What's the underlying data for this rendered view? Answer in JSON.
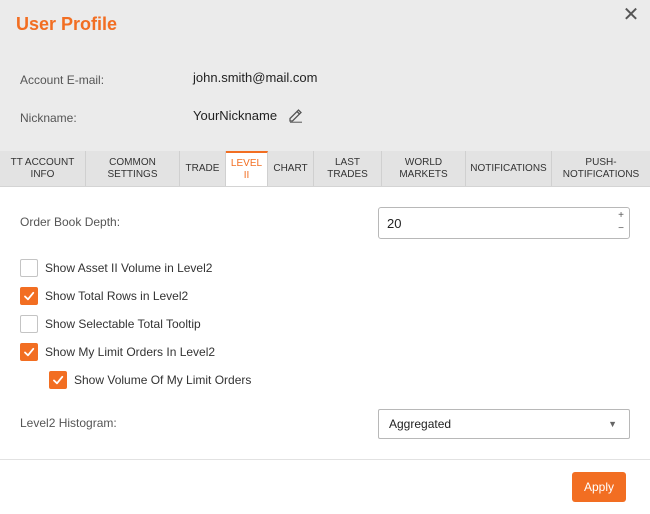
{
  "dialog": {
    "title": "User Profile",
    "close_icon": "close-icon"
  },
  "account": {
    "email_label": "Account E-mail:",
    "email_value": "john.smith@mail.com",
    "nickname_label": "Nickname:",
    "nickname_value": "YourNickname",
    "edit_icon": "pencil-icon"
  },
  "tabs": [
    {
      "label": "TT ACCOUNT\nINFO",
      "active": false
    },
    {
      "label": "COMMON\nSETTINGS",
      "active": false
    },
    {
      "label": "TRADE",
      "active": false
    },
    {
      "label": "LEVEL\nII",
      "active": true
    },
    {
      "label": "CHART",
      "active": false
    },
    {
      "label": "LAST\nTRADES",
      "active": false
    },
    {
      "label": "WORLD\nMARKETS",
      "active": false
    },
    {
      "label": "NOTIFICATIONS",
      "active": false
    },
    {
      "label": "PUSH-\nNOTIFICATIONS",
      "active": false
    }
  ],
  "level2": {
    "order_book_depth_label": "Order Book Depth:",
    "order_book_depth_value": "20",
    "stepper_up": "+",
    "stepper_down": "−",
    "options": [
      {
        "label": "Show Asset II Volume in Level2",
        "checked": false
      },
      {
        "label": "Show Total Rows in Level2",
        "checked": true
      },
      {
        "label": "Show Selectable Total Tooltip",
        "checked": false
      },
      {
        "label": "Show My Limit Orders In Level2",
        "checked": true
      },
      {
        "label": "Show Volume Of My Limit Orders",
        "checked": true
      }
    ],
    "histogram_label": "Level2 Histogram:",
    "histogram_value": "Aggregated",
    "histogram_arrow": "▼"
  },
  "footer": {
    "apply_label": "Apply"
  },
  "colors": {
    "accent": "#f26e22",
    "header_bg": "#ebebeb",
    "tabs_bg": "#e3e3e3"
  }
}
